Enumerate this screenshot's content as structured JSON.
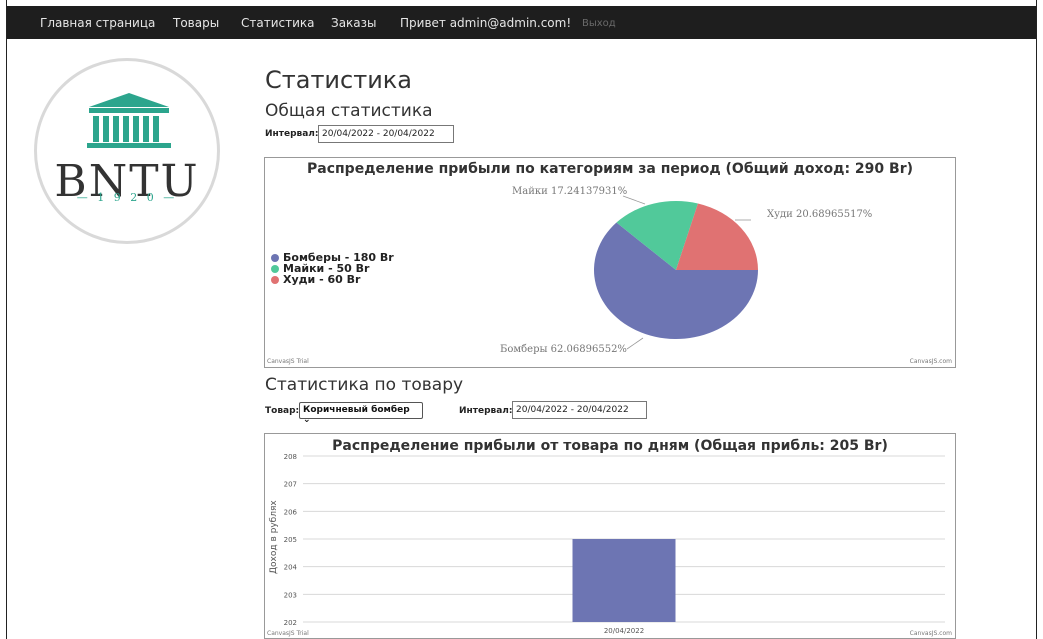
{
  "nav": {
    "home": "Главная страница",
    "products": "Товары",
    "stats": "Статистика",
    "orders": "Заказы",
    "greeting": "Привет admin@admin.com!",
    "logout": "Выход"
  },
  "logo": {
    "text": "BNTU",
    "year": "— 1 9 2 0 —"
  },
  "page": {
    "title": "Статистика",
    "general_heading": "Общая статистика",
    "interval_label": "Интервал:",
    "interval_value": "20/04/2022 - 20/04/2022",
    "product_heading": "Статистика по товару",
    "product_label": "Товар:",
    "product_value": "Коричневый бомбер ⌄",
    "product_interval_label": "Интервал:",
    "product_interval_value": "20/04/2022 - 20/04/2022"
  },
  "chart_data": [
    {
      "type": "pie",
      "title": "Распределение прибыли по категориям за период (Общий доход: 290 Br)",
      "legend": [
        "Бомберы - 180 Br",
        "Майки - 50 Br",
        "Худи - 60 Br"
      ],
      "slices": [
        {
          "name": "Бомберы",
          "value": 180,
          "label": "Бомберы 62.06896552%",
          "color": "#6d75b3"
        },
        {
          "name": "Майки",
          "value": 50,
          "label": "Майки 17.24137931%",
          "color": "#51c99a"
        },
        {
          "name": "Худи",
          "value": 60,
          "label": "Худи 20.68965517%",
          "color": "#e07272"
        }
      ],
      "trial_left": "CanvasJS Trial",
      "trial_right": "CanvasJS.com"
    },
    {
      "type": "bar",
      "title": "Распределение прибыли от товара по дням (Общая прибль: 205 Br)",
      "categories": [
        "20/04/2022"
      ],
      "values": [
        205
      ],
      "ylabel": "Доход в рублях",
      "ylim": [
        202,
        208
      ],
      "yticks": [
        "208",
        "207",
        "206",
        "205",
        "204",
        "203",
        "202"
      ],
      "color": "#6d75b3",
      "trial_left": "CanvasJS Trial",
      "trial_right": "CanvasJS.com"
    }
  ]
}
